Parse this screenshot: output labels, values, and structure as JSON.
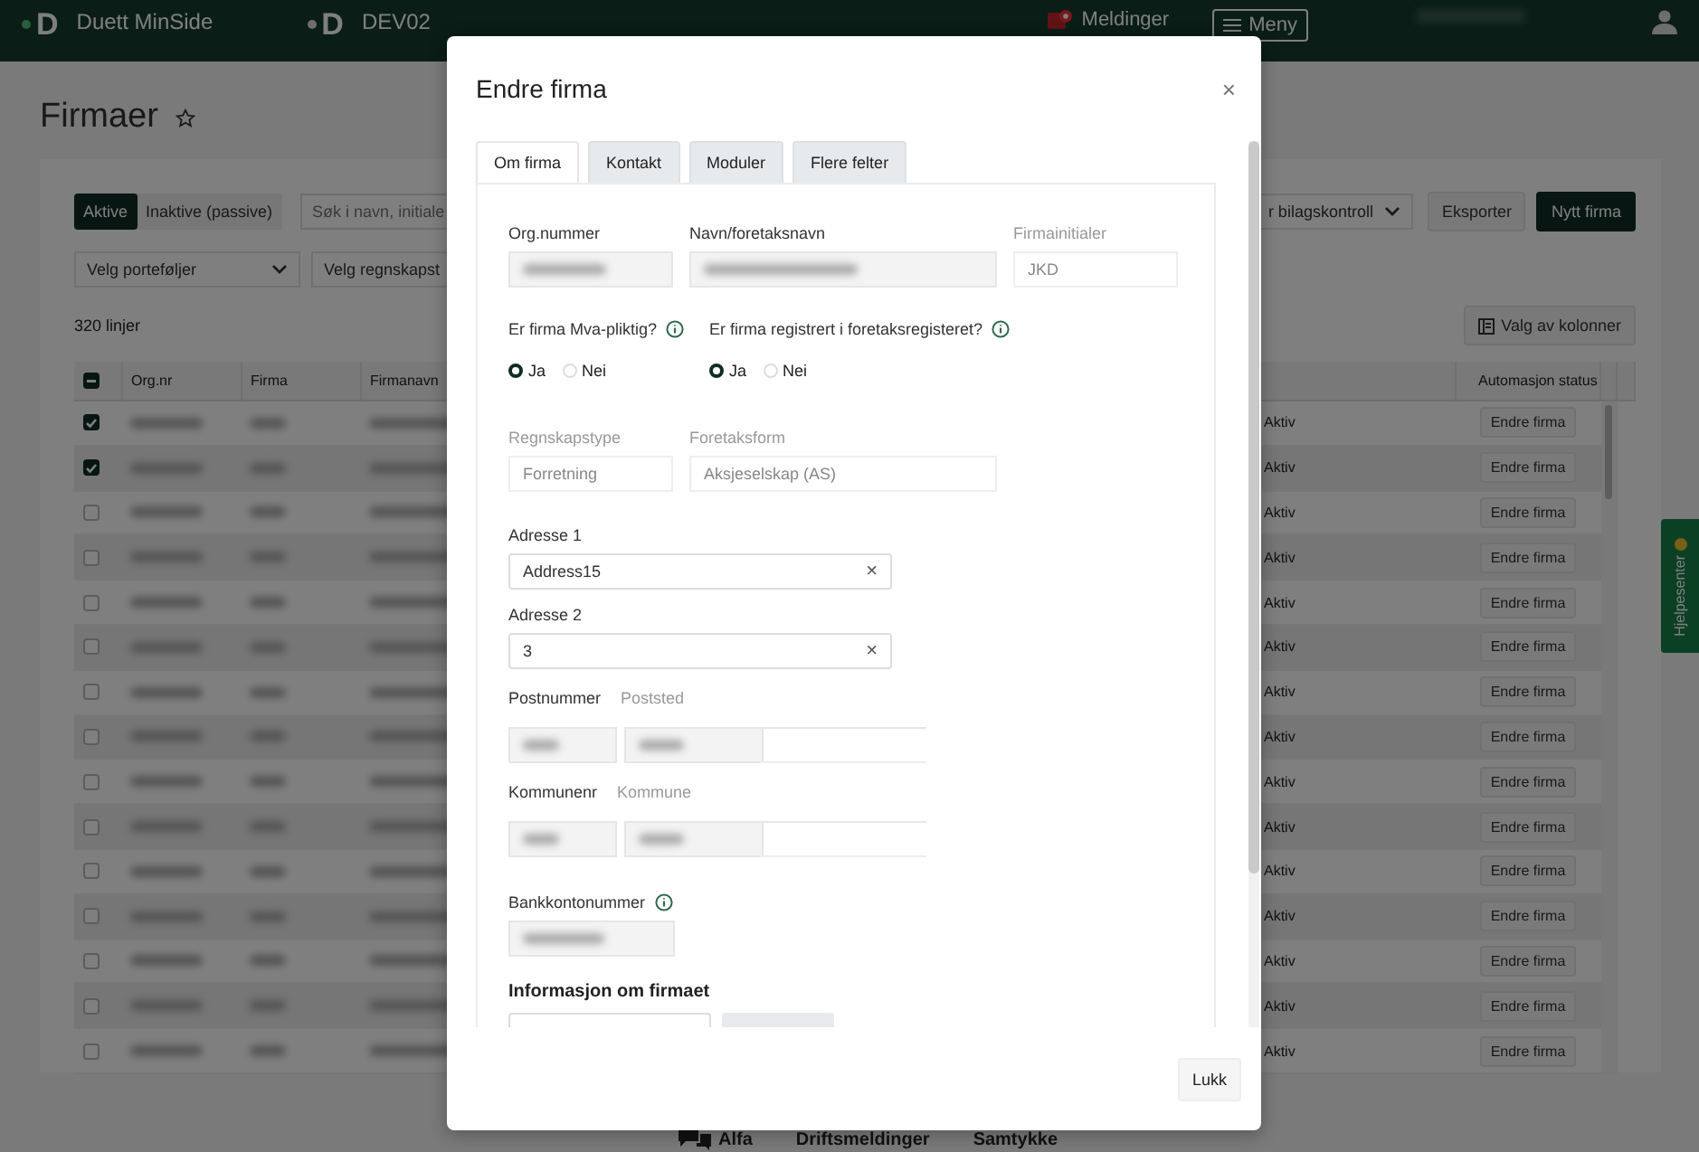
{
  "topbar": {
    "brand_logo": "D",
    "env_logo": "D",
    "brand": "Duett MinSide",
    "environment": "DEV02",
    "messages": "Meldinger",
    "menu": "Meny"
  },
  "page": {
    "title": "Firmaer",
    "favorite": false
  },
  "toolbar": {
    "status_tabs": [
      {
        "label": "Aktive",
        "selected": true
      },
      {
        "label": "Inaktive (passive)",
        "selected": false
      }
    ],
    "search": {
      "placeholder": "Søk i navn, initiale"
    },
    "filter": "r bilagskontroll",
    "buttons": [
      {
        "label": "Eksporter",
        "kind": "secondary"
      },
      {
        "label": "Nytt firma",
        "kind": "primary"
      }
    ]
  },
  "filters": [
    "Velg porteføljer",
    "Velg regnskapst"
  ],
  "row_count": "320 linjer",
  "column_chooser": "Valg av kolonner",
  "table": {
    "select_all": {
      "indeterminate": true
    },
    "columns_left": [
      "Org.nr",
      "Firma",
      "Firmanavn"
    ],
    "columns_right": [
      "Automasjon status"
    ],
    "rows": [
      {
        "checked": true,
        "status": "Aktiv",
        "action": "Endre firma"
      },
      {
        "checked": true,
        "status": "Aktiv",
        "action": "Endre firma"
      },
      {
        "checked": false,
        "status": "Aktiv",
        "action": "Endre firma"
      },
      {
        "checked": false,
        "status": "Aktiv",
        "action": "Endre firma"
      },
      {
        "checked": false,
        "status": "Aktiv",
        "action": "Endre firma"
      },
      {
        "checked": false,
        "status": "Aktiv",
        "action": "Endre firma"
      },
      {
        "checked": false,
        "status": "Aktiv",
        "action": "Endre firma"
      },
      {
        "checked": false,
        "status": "Aktiv",
        "action": "Endre firma"
      },
      {
        "checked": false,
        "status": "Aktiv",
        "action": "Endre firma"
      },
      {
        "checked": false,
        "status": "Aktiv",
        "action": "Endre firma"
      },
      {
        "checked": false,
        "status": "Aktiv",
        "action": "Endre firma"
      },
      {
        "checked": false,
        "status": "Aktiv",
        "action": "Endre firma"
      },
      {
        "checked": false,
        "status": "Aktiv",
        "action": "Endre firma"
      },
      {
        "checked": false,
        "status": "Aktiv",
        "action": "Endre firma"
      },
      {
        "checked": false,
        "status": "Aktiv",
        "action": "Endre firma"
      }
    ]
  },
  "help_tab": "Hjelpesenter",
  "footer": [
    {
      "label": "Alfa",
      "kind": "chat"
    },
    {
      "label": "Driftsmeldinger",
      "kind": "link"
    },
    {
      "label": "Samtykke",
      "kind": "link"
    }
  ],
  "dialog": {
    "title": "Endre firma",
    "close_icon": "×",
    "tabs": [
      {
        "label": "Om firma",
        "selected": true
      },
      {
        "label": "Kontakt",
        "selected": false
      },
      {
        "label": "Moduler",
        "selected": false
      },
      {
        "label": "Flere felter",
        "selected": false
      }
    ],
    "row1": [
      {
        "label": "Org.nummer",
        "disabled": false,
        "redacted": true
      },
      {
        "label": "Navn/foretaksnavn",
        "disabled": false,
        "redacted": true
      },
      {
        "label": "Firmainitialer",
        "disabled": true,
        "value": "JKD"
      }
    ],
    "questions": [
      {
        "label": "Er firma Mva-pliktig?",
        "options": [
          {
            "label": "Ja",
            "selected": true
          },
          {
            "label": "Nei",
            "selected": false
          }
        ]
      },
      {
        "label": "Er firma registrert i foretaksregisteret?",
        "options": [
          {
            "label": "Ja",
            "selected": true
          },
          {
            "label": "Nei",
            "selected": false
          }
        ]
      }
    ],
    "row2": [
      {
        "label": "Regnskapstype",
        "disabled": true,
        "value": "Forretning"
      },
      {
        "label": "Foretaksform",
        "disabled": true,
        "value": "Aksjeselskap (AS)"
      }
    ],
    "addresses": [
      {
        "label": "Adresse 1",
        "value": "Address15",
        "clear": "×"
      },
      {
        "label": "Adresse 2",
        "value": "3",
        "clear": "×"
      }
    ],
    "place_rows": [
      {
        "code_label": "Postnummer",
        "name_label": "Poststed"
      },
      {
        "code_label": "Kommunenr",
        "name_label": "Kommune"
      }
    ],
    "bank_account": {
      "label": "Bankkontonummer"
    },
    "section": "Informasjon om firmaet",
    "close_button": "Lukk"
  }
}
